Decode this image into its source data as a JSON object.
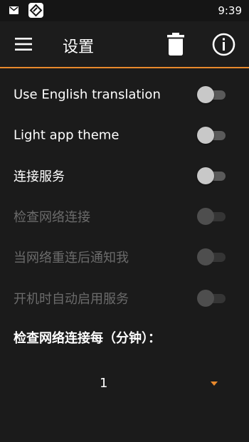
{
  "status_bar": {
    "time": "9:39",
    "icons": [
      "mail-icon",
      "app-notification-icon"
    ]
  },
  "app_bar": {
    "title": "设置",
    "icons": [
      "menu-icon",
      "trash-icon",
      "info-icon"
    ],
    "accent_color": "#e8892c"
  },
  "settings": [
    {
      "label": "Use English translation",
      "enabled": true,
      "checked": false
    },
    {
      "label": "Light app theme",
      "enabled": true,
      "checked": false
    },
    {
      "label": "连接服务",
      "enabled": true,
      "checked": false
    },
    {
      "label": "检查网络连接",
      "enabled": false,
      "checked": false
    },
    {
      "label": "当网络重连后通知我",
      "enabled": false,
      "checked": false
    },
    {
      "label": "开机时自动启用服务",
      "enabled": false,
      "checked": false
    }
  ],
  "interval": {
    "heading": "检查网络连接每（分钟）：",
    "selected_value": "1"
  }
}
